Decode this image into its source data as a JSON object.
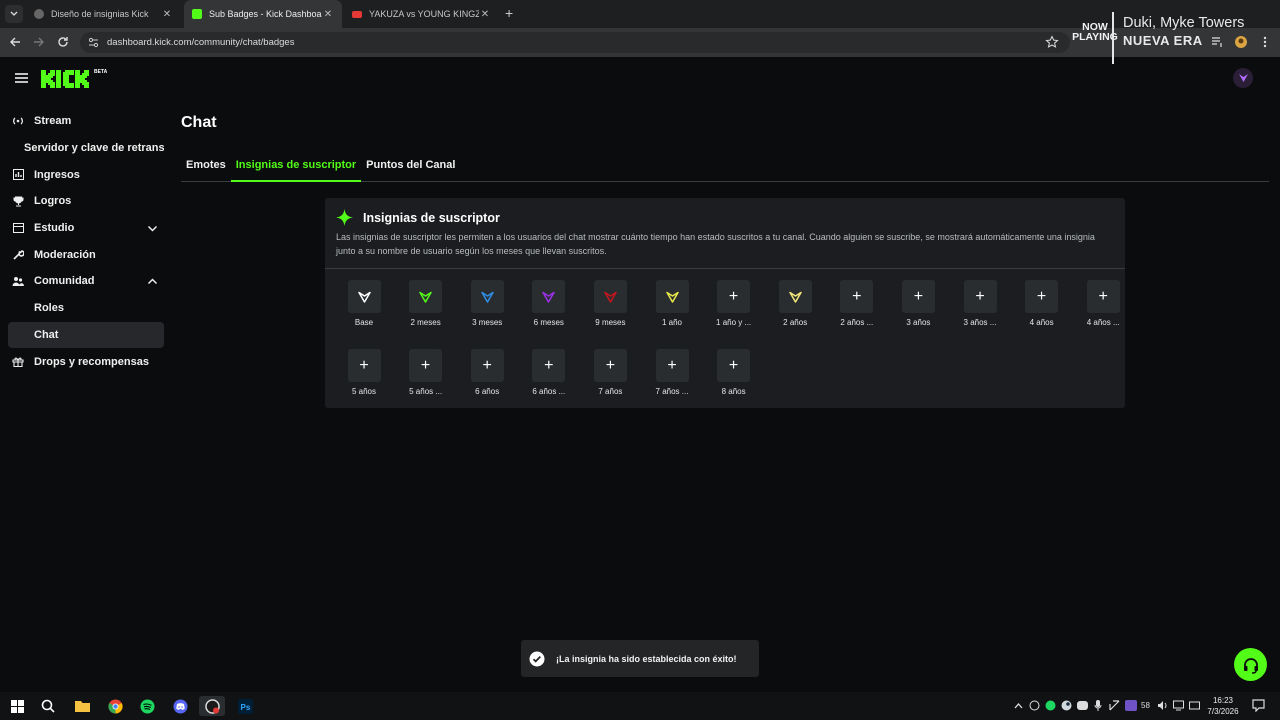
{
  "browser": {
    "tabs": [
      {
        "title": "Diseño de insignias Kick",
        "active": false
      },
      {
        "title": "Sub Badges - Kick Dashboard",
        "active": true
      },
      {
        "title": "YAKUZA vs YOUNG KINGZ | GR",
        "active": false
      }
    ],
    "url": "dashboard.kick.com/community/chat/badges"
  },
  "now_playing": {
    "label_line1": "NOW",
    "label_line2": "PLAYING",
    "artist": "Duki, Myke Towers",
    "track": "NUEVA ERA"
  },
  "app": {
    "beta": "BETA",
    "sidebar": [
      {
        "label": "Stream",
        "icon": "broadcast-icon"
      },
      {
        "label": "Servidor y clave de retransmisión",
        "icon": ""
      },
      {
        "label": "Ingresos",
        "icon": "chart-icon"
      },
      {
        "label": "Logros",
        "icon": "trophy-icon"
      },
      {
        "label": "Estudio",
        "icon": "studio-icon"
      },
      {
        "label": "Moderación",
        "icon": "wrench-icon"
      },
      {
        "label": "Comunidad",
        "icon": "people-icon"
      },
      {
        "label": "Roles",
        "icon": ""
      },
      {
        "label": "Chat",
        "icon": ""
      },
      {
        "label": "Drops y recompensas",
        "icon": "gift-icon"
      }
    ],
    "page_title": "Chat",
    "tabs": [
      "Emotes",
      "Insignias de suscriptor",
      "Puntos del Canal"
    ],
    "card": {
      "title": "Insignias de suscriptor",
      "description": "Las insignias de suscriptor les permiten a los usuarios del chat mostrar cuánto tiempo han estado suscritos a tu canal. Cuando alguien se suscribe, se mostrará automáticamente una insignia junto a su nombre de usuario según los meses que llevan suscritos."
    },
    "badges": [
      {
        "label": "Base",
        "color": "#ffffff"
      },
      {
        "label": "2 meses",
        "color": "#53fc18"
      },
      {
        "label": "3 meses",
        "color": "#2f8fe6"
      },
      {
        "label": "6 meses",
        "color": "#9b30e8"
      },
      {
        "label": "9 meses",
        "color": "#c4161c"
      },
      {
        "label": "1 año",
        "color": "#e8e84a"
      },
      {
        "label": "1 año y ...",
        "color": ""
      },
      {
        "label": "2 años",
        "color": "#f3e77a"
      },
      {
        "label": "2 años ...",
        "color": ""
      },
      {
        "label": "3 años",
        "color": ""
      },
      {
        "label": "3 años ...",
        "color": ""
      },
      {
        "label": "4 años",
        "color": ""
      },
      {
        "label": "4 años ...",
        "color": ""
      },
      {
        "label": "5 años",
        "color": ""
      },
      {
        "label": "5 años ...",
        "color": ""
      },
      {
        "label": "6 años",
        "color": ""
      },
      {
        "label": "6 años ...",
        "color": ""
      },
      {
        "label": "7 años",
        "color": ""
      },
      {
        "label": "7 años ...",
        "color": ""
      },
      {
        "label": "8 años",
        "color": ""
      }
    ],
    "add_symbol": "+",
    "toast": "¡La insignia ha sido establecida con éxito!"
  },
  "taskbar": {
    "time": "16:23",
    "date": "7/3/2026",
    "tray_count": "58"
  },
  "colors": {
    "accent": "#53fc18",
    "background": "#0b0c0d",
    "card": "#1b1d20"
  }
}
